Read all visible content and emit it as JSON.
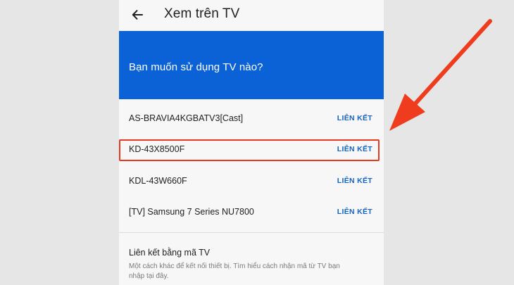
{
  "app_bar": {
    "title": "Xem trên TV",
    "back_icon": "arrow-left-icon"
  },
  "hero": {
    "prompt": "Bạn muốn sử dụng TV nào?",
    "color": "#0a62d6"
  },
  "devices": [
    {
      "name": "AS-BRAVIA4KGBATV3[Cast]",
      "action": "LIÊN KẾT"
    },
    {
      "name": "KD-43X8500F",
      "action": "LIÊN KẾT"
    },
    {
      "name": "KDL-43W660F",
      "action": "LIÊN KẾT"
    },
    {
      "name": "[TV] Samsung 7 Series NU7800",
      "action": "LIÊN KẾT"
    }
  ],
  "alt_link": {
    "title": "Liên kết bằng mã TV",
    "description": "Một cách khác để kết nối thiết bị. Tìm hiểu cách nhận mã từ TV bạn nhập tại đây."
  },
  "annotation": {
    "highlight_color": "#e53a20",
    "arrow_color": "#f03c1e"
  }
}
